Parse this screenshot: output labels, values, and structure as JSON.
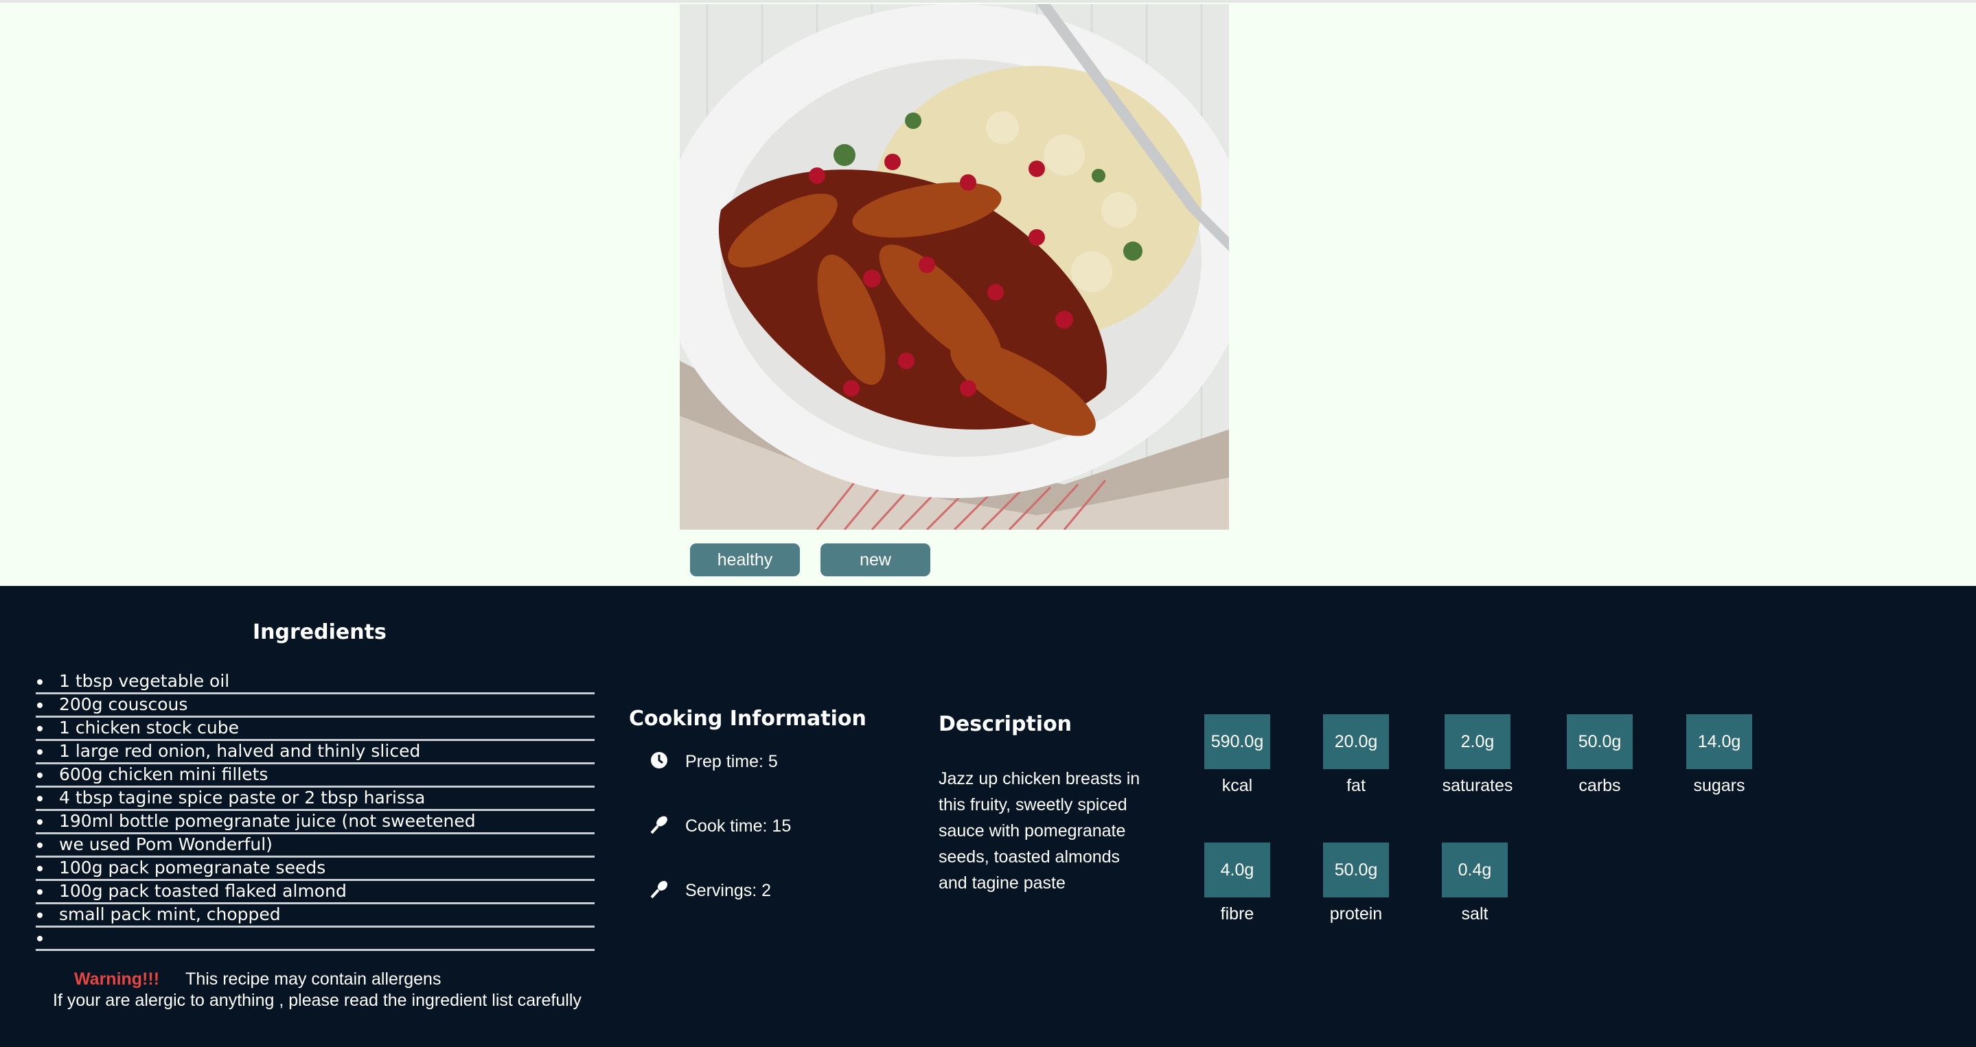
{
  "tags": [
    "healthy",
    "new"
  ],
  "ingredients": {
    "title": "Ingredients",
    "items": [
      "1 tbsp vegetable oil",
      "200g couscous",
      "1 chicken stock cube",
      "1 large red onion, halved and thinly sliced",
      "600g chicken mini fillets",
      "4 tbsp tagine spice paste or 2 tbsp harissa",
      "190ml bottle pomegranate juice (not sweetened",
      "we used Pom Wonderful)",
      "100g pack pomegranate seeds",
      "100g pack toasted flaked almond",
      "small pack mint, chopped",
      ""
    ]
  },
  "warning": {
    "label": "Warning!!!",
    "text": "This recipe may contain allergens",
    "line2": "If your are alergic to anything , please read the ingredient list carefully"
  },
  "cooking": {
    "title": "Cooking Information",
    "prep": "Prep time: 5",
    "cook": "Cook time: 15",
    "servings": "Servings: 2"
  },
  "description": {
    "title": "Description",
    "text": "Jazz up chicken breasts in this fruity, sweetly spiced sauce with pomegranate seeds, toasted almonds and tagine paste"
  },
  "nutrition": [
    {
      "value": "590.0g",
      "label": "kcal"
    },
    {
      "value": "20.0g",
      "label": "fat"
    },
    {
      "value": "2.0g",
      "label": "saturates"
    },
    {
      "value": "50.0g",
      "label": "carbs"
    },
    {
      "value": "14.0g",
      "label": "sugars"
    },
    {
      "value": "4.0g",
      "label": "fibre"
    },
    {
      "value": "50.0g",
      "label": "protein"
    },
    {
      "value": "0.4g",
      "label": "salt"
    }
  ],
  "colors": {
    "page_bg": "#f6fff4",
    "panel_bg": "#061424",
    "tag_bg": "#4f7d86",
    "nutrition_bg": "#2e6a74",
    "warning": "#e64540"
  }
}
